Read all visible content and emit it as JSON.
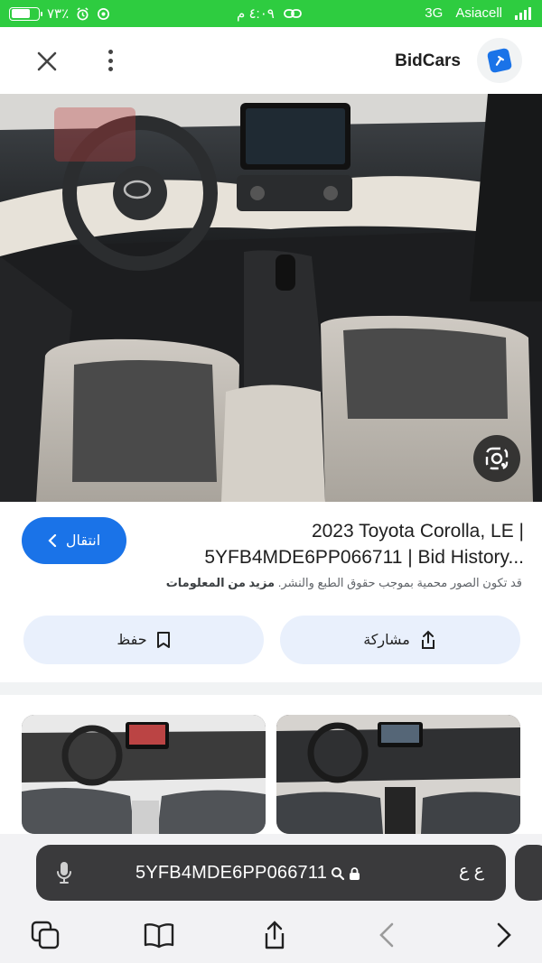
{
  "status_bar": {
    "battery_text": "٧٣٪",
    "battery_level": 0.73,
    "time": "٤:٠٩ م",
    "network": "3G",
    "carrier": "Asiacell"
  },
  "header": {
    "site_name": "BidCars",
    "icons": [
      "close-icon",
      "more-vertical-icon",
      "bidcars-logo-icon"
    ]
  },
  "result": {
    "title_line1": "2023 Toyota Corolla, LE |",
    "title_line2": "5YFB4MDE6PP066711 | Bid History...",
    "visit_label": "انتقال",
    "copyright_text": "قد تكون الصور محمية بموجب حقوق الطبع والنشر.",
    "more_info_label": "مزيد من المعلومات",
    "share_label": "مشاركة",
    "save_label": "حفظ"
  },
  "url_bar": {
    "url": "5YFB4MDE6PP066711",
    "text_size_label": "ع ع"
  },
  "toolbar": {
    "icons": [
      "tabs-icon",
      "bookmarks-icon",
      "share-icon",
      "back-arrow-icon",
      "forward-arrow-icon"
    ]
  },
  "colors": {
    "status_bar_bg": "#2ecc40",
    "accent": "#1a73e8",
    "action_bg": "#e9f0fc"
  }
}
